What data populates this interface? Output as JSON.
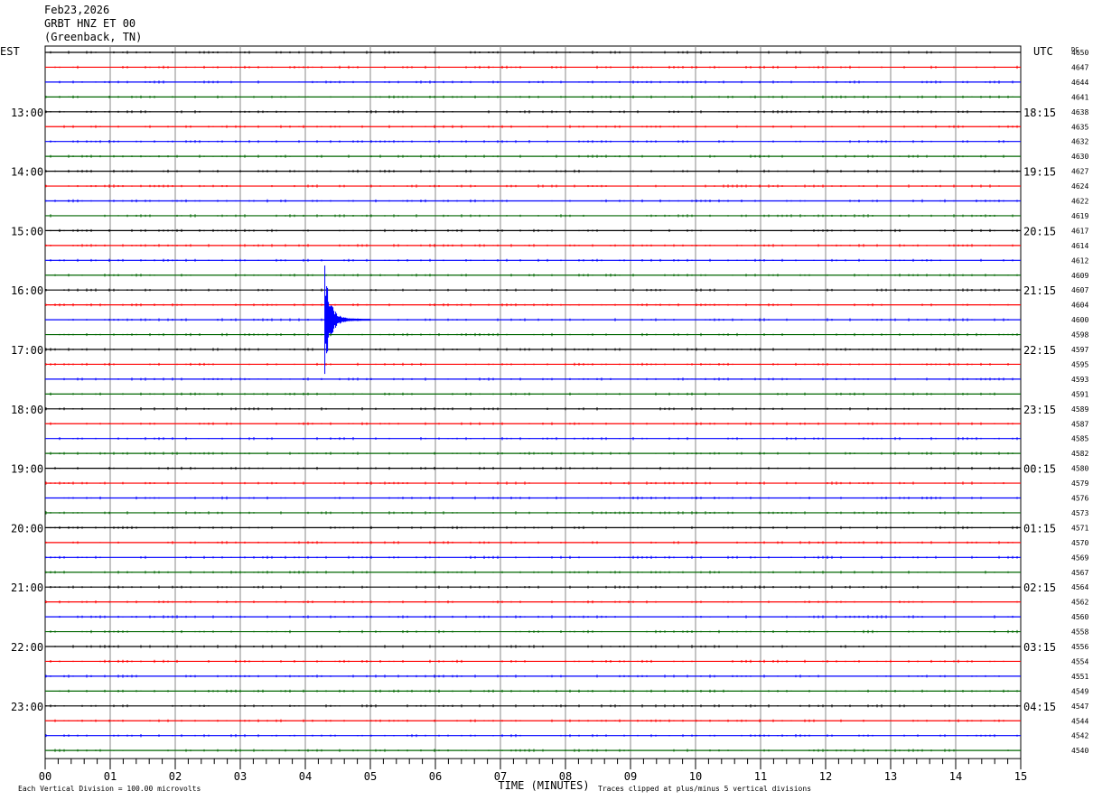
{
  "header": {
    "date": "Feb23,2026",
    "station": "GRBT HNZ ET 00",
    "location": "(Greenback, TN)"
  },
  "chart_data": {
    "type": "line",
    "title": "GRBT HNZ ET 00",
    "left_axis_label": "EST",
    "right_axis_label": "UTC",
    "dc_label": "DC",
    "xlabel": "TIME (MINUTES)",
    "xlim": [
      0,
      15
    ],
    "x_ticks": [
      "00",
      "01",
      "02",
      "03",
      "04",
      "05",
      "06",
      "07",
      "08",
      "09",
      "10",
      "11",
      "12",
      "13",
      "14",
      "15"
    ],
    "est_labels": [
      "13:00",
      "14:00",
      "15:00",
      "16:00",
      "17:00",
      "18:00",
      "19:00",
      "20:00",
      "21:00",
      "22:00",
      "23:00"
    ],
    "utc_labels": [
      "18:15",
      "19:15",
      "20:15",
      "21:15",
      "22:15",
      "23:15",
      "00:15",
      "01:15",
      "02:15",
      "03:15",
      "04:15"
    ],
    "dc_values": [
      "4650",
      "4647",
      "4644",
      "4641",
      "4638",
      "4635",
      "4632",
      "4630",
      "4627",
      "4624",
      "4622",
      "4619",
      "4617",
      "4614",
      "4612",
      "4609",
      "4607",
      "4604",
      "4600",
      "4598",
      "4597",
      "4595",
      "4593",
      "4591",
      "4589",
      "4587",
      "4585",
      "4582",
      "4580",
      "4579",
      "4576",
      "4573",
      "4571",
      "4570",
      "4569",
      "4567",
      "4564",
      "4562",
      "4560",
      "4558",
      "4556",
      "4554",
      "4551",
      "4549",
      "4547",
      "4544",
      "4542",
      "4540"
    ],
    "trace_colors": [
      "#000000",
      "#ff0000",
      "#0000ff",
      "#006600"
    ],
    "grid": true,
    "event": {
      "trace_index": 18,
      "minute": 4.3,
      "amplitude_divisions": 5,
      "note": "clipped"
    },
    "footer_left": "Each Vertical Division =  100.00 microvolts",
    "footer_right": "Traces clipped at plus/minus 5 vertical divisions"
  }
}
